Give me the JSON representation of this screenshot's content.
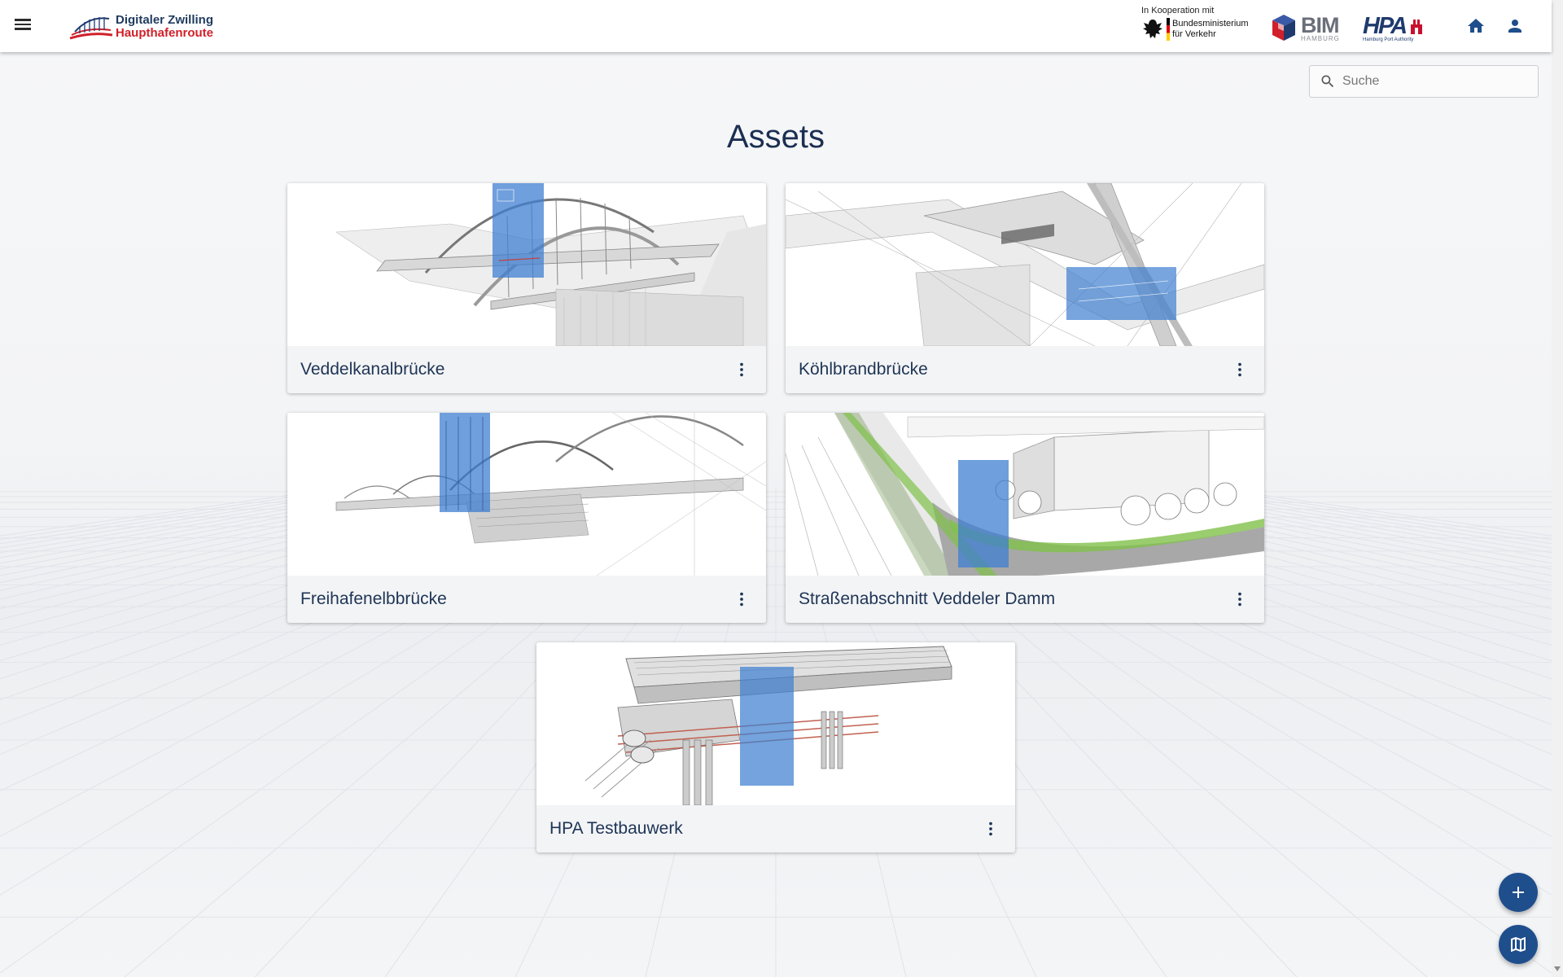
{
  "header": {
    "brand_line1": "Digitaler Zwilling",
    "brand_line2": "Haupthafenroute",
    "coop_label": "In Kooperation mit",
    "ministry_line1": "Bundesministerium",
    "ministry_line2": "für Verkehr",
    "bim_label": "BIM",
    "bim_sub": "HAMBURG",
    "hpa_label": "HPA",
    "hpa_sub": "Hamburg Port Authority"
  },
  "search": {
    "placeholder": "Suche",
    "value": ""
  },
  "page": {
    "title": "Assets"
  },
  "assets": [
    {
      "name": "Veddelkanalbrücke"
    },
    {
      "name": "Köhlbrandbrücke"
    },
    {
      "name": "Freihafenelbbrücke"
    },
    {
      "name": "Straßenabschnitt Veddeler Damm"
    },
    {
      "name": "HPA Testbauwerk"
    }
  ],
  "colors": {
    "accent": "#1f4e8c",
    "brand_red": "#d1202a",
    "title": "#1b2f52",
    "highlight": "#3f7fd0"
  },
  "icons": [
    "menu-icon",
    "home-icon",
    "account-icon",
    "search-icon",
    "more-vert-icon",
    "add-icon",
    "map-icon"
  ]
}
